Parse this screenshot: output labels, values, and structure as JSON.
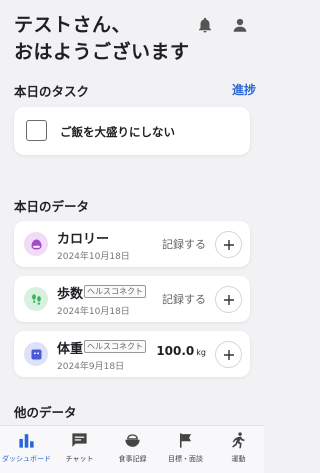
{
  "header": {
    "greeting_line1": "テストさん、",
    "greeting_line2": "おはようございます"
  },
  "tasks": {
    "title": "本日のタスク",
    "progress_label": "進捗",
    "items": [
      {
        "label": "ご飯を大盛りにしない",
        "checked": false
      }
    ]
  },
  "today_data": {
    "title": "本日のデータ",
    "items": [
      {
        "name": "カロリー",
        "date": "2024年10月18日",
        "action": "記録する",
        "icon": "rice-icon",
        "icon_color": "#a349c9"
      },
      {
        "name": "歩数",
        "tag": "ヘルスコネクト",
        "date": "2024年10月18日",
        "action": "記録する",
        "icon": "footprints-icon",
        "icon_color": "#3bb35b"
      },
      {
        "name": "体重",
        "tag": "ヘルスコネクト",
        "date": "2024年9月18日",
        "value": "100.0",
        "unit": "kg",
        "icon": "scale-icon",
        "icon_color": "#4a5bd6"
      }
    ]
  },
  "other_data": {
    "title": "他のデータ"
  },
  "nav": {
    "active_color": "#2a66d8",
    "items": [
      {
        "label": "ダッシュボード",
        "icon": "dashboard-icon",
        "active": true
      },
      {
        "label": "チャット",
        "icon": "chat-icon",
        "active": false
      },
      {
        "label": "食事記録",
        "icon": "meal-icon",
        "active": false
      },
      {
        "label": "目標・面談",
        "icon": "flag-icon",
        "active": false
      },
      {
        "label": "運動",
        "icon": "exercise-icon",
        "active": false
      }
    ]
  }
}
